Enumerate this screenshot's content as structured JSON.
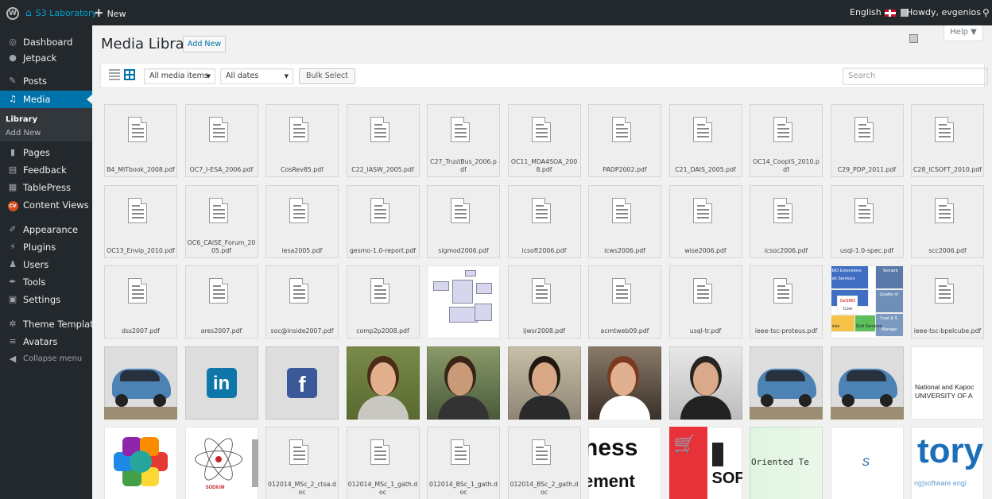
{
  "adminbar": {
    "site_name": "S3 Laboratory",
    "new_label": "New",
    "language": "English",
    "howdy": "Howdy, evgenios"
  },
  "sidebar": {
    "items": [
      {
        "label": "Dashboard",
        "icon": "dashboard-icon"
      },
      {
        "label": "Jetpack",
        "icon": "jetpack-icon"
      },
      {
        "label": "Posts",
        "icon": "pin-icon"
      },
      {
        "label": "Media",
        "icon": "media-icon"
      },
      {
        "label": "Pages",
        "icon": "pages-icon"
      },
      {
        "label": "Feedback",
        "icon": "feedback-icon"
      },
      {
        "label": "TablePress",
        "icon": "table-icon"
      },
      {
        "label": "Content Views",
        "icon": "cv-icon"
      },
      {
        "label": "Appearance",
        "icon": "brush-icon"
      },
      {
        "label": "Plugins",
        "icon": "plugin-icon"
      },
      {
        "label": "Users",
        "icon": "users-icon"
      },
      {
        "label": "Tools",
        "icon": "wrench-icon"
      },
      {
        "label": "Settings",
        "icon": "settings-icon"
      },
      {
        "label": "Theme Templates",
        "icon": "gear-icon"
      },
      {
        "label": "Avatars",
        "icon": "avatars-icon"
      },
      {
        "label": "Collapse menu",
        "icon": "collapse-icon"
      }
    ],
    "submenu": [
      "Library",
      "Add New"
    ]
  },
  "header": {
    "title": "Media Library",
    "add_new": "Add New",
    "help": "Help ▼"
  },
  "toolbar": {
    "type_filter": "All media items",
    "date_filter": "All dates",
    "bulk_select": "Bulk Select",
    "search_placeholder": "Search"
  },
  "media": [
    {
      "type": "doc",
      "name": "B4_MITbook_2008.pdf"
    },
    {
      "type": "doc",
      "name": "OC7_I-ESA_2006.pdf"
    },
    {
      "type": "doc",
      "name": "CosRev85.pdf"
    },
    {
      "type": "doc",
      "name": "C22_IASW_2005.pdf"
    },
    {
      "type": "doc",
      "name": "C27_TrustBus_2006.pdf"
    },
    {
      "type": "doc",
      "name": "OC11_MDA4SOA_2008.pdf"
    },
    {
      "type": "doc",
      "name": "PADP2002.pdf"
    },
    {
      "type": "doc",
      "name": "C21_DAIS_2005.pdf"
    },
    {
      "type": "doc",
      "name": "OC14_CoopIS_2010.pdf"
    },
    {
      "type": "doc",
      "name": "C29_PDP_2011.pdf"
    },
    {
      "type": "doc",
      "name": "C28_ICSOFT_2010.pdf"
    },
    {
      "type": "doc",
      "name": "OC13_Envip_2010.pdf"
    },
    {
      "type": "doc",
      "name": "OC6_CAiSE_Forum_2005.pdf"
    },
    {
      "type": "doc",
      "name": "iesa2005.pdf"
    },
    {
      "type": "doc",
      "name": "gesmo-1.0-report.pdf"
    },
    {
      "type": "doc",
      "name": "sigmod2006.pdf"
    },
    {
      "type": "doc",
      "name": "icsoft2006.pdf"
    },
    {
      "type": "doc",
      "name": "icws2006.pdf"
    },
    {
      "type": "doc",
      "name": "wise2006.pdf"
    },
    {
      "type": "doc",
      "name": "icsoc2006.pdf"
    },
    {
      "type": "doc",
      "name": "usql-1.0-spec.pdf"
    },
    {
      "type": "doc",
      "name": "scc2006.pdf"
    },
    {
      "type": "doc",
      "name": "dss2007.pdf"
    },
    {
      "type": "doc",
      "name": "ares2007.pdf"
    },
    {
      "type": "doc",
      "name": "soc@inside2007.pdf"
    },
    {
      "type": "doc",
      "name": "comp2p2008.pdf"
    },
    {
      "type": "img",
      "kind": "diagram"
    },
    {
      "type": "doc",
      "name": "ijwsr2008.pdf"
    },
    {
      "type": "doc",
      "name": "acmtweb09.pdf"
    },
    {
      "type": "doc",
      "name": "usql-tr.pdf"
    },
    {
      "type": "doc",
      "name": "ieee-tsc-proteus.pdf"
    },
    {
      "type": "img",
      "kind": "gesmo",
      "text": [
        "MO Extensions",
        "eb Services",
        "GeSMO",
        "Core",
        "ices",
        "Grid Services",
        "Semant",
        "Quality of",
        "Trust & S",
        "Manage"
      ]
    },
    {
      "type": "doc",
      "name": "ieee-tsc-bpelcube.pdf"
    },
    {
      "type": "img",
      "kind": "car"
    },
    {
      "type": "img",
      "kind": "linkedin",
      "text": "in"
    },
    {
      "type": "img",
      "kind": "facebook",
      "text": "f"
    },
    {
      "type": "img",
      "kind": "person1"
    },
    {
      "type": "img",
      "kind": "person2"
    },
    {
      "type": "img",
      "kind": "person3"
    },
    {
      "type": "img",
      "kind": "person4"
    },
    {
      "type": "img",
      "kind": "person5"
    },
    {
      "type": "img",
      "kind": "car"
    },
    {
      "type": "img",
      "kind": "car"
    },
    {
      "type": "img",
      "kind": "university",
      "text": [
        "National and Kapoc",
        "UNIVERSITY OF A"
      ]
    },
    {
      "type": "img",
      "kind": "puzzle"
    },
    {
      "type": "img",
      "kind": "atom",
      "text": "SODIUM"
    },
    {
      "type": "doc",
      "name": "012014_MSc_2_ctsa.doc"
    },
    {
      "type": "doc",
      "name": "012014_MSc_1_gath.doc"
    },
    {
      "type": "doc",
      "name": "012014_BSc_1_gath.doc"
    },
    {
      "type": "doc",
      "name": "012014_BSc_2_gath.doc"
    },
    {
      "type": "img",
      "kind": "business",
      "text": [
        "ness",
        "ement"
      ]
    },
    {
      "type": "img",
      "kind": "cart",
      "text": "SOF"
    },
    {
      "type": "img",
      "kind": "oriented",
      "text": "Oriented Te"
    },
    {
      "type": "img",
      "kind": "symbol",
      "text": "S"
    },
    {
      "type": "img",
      "kind": "tory",
      "text": "tory",
      "sub": "ng|software engi"
    }
  ]
}
